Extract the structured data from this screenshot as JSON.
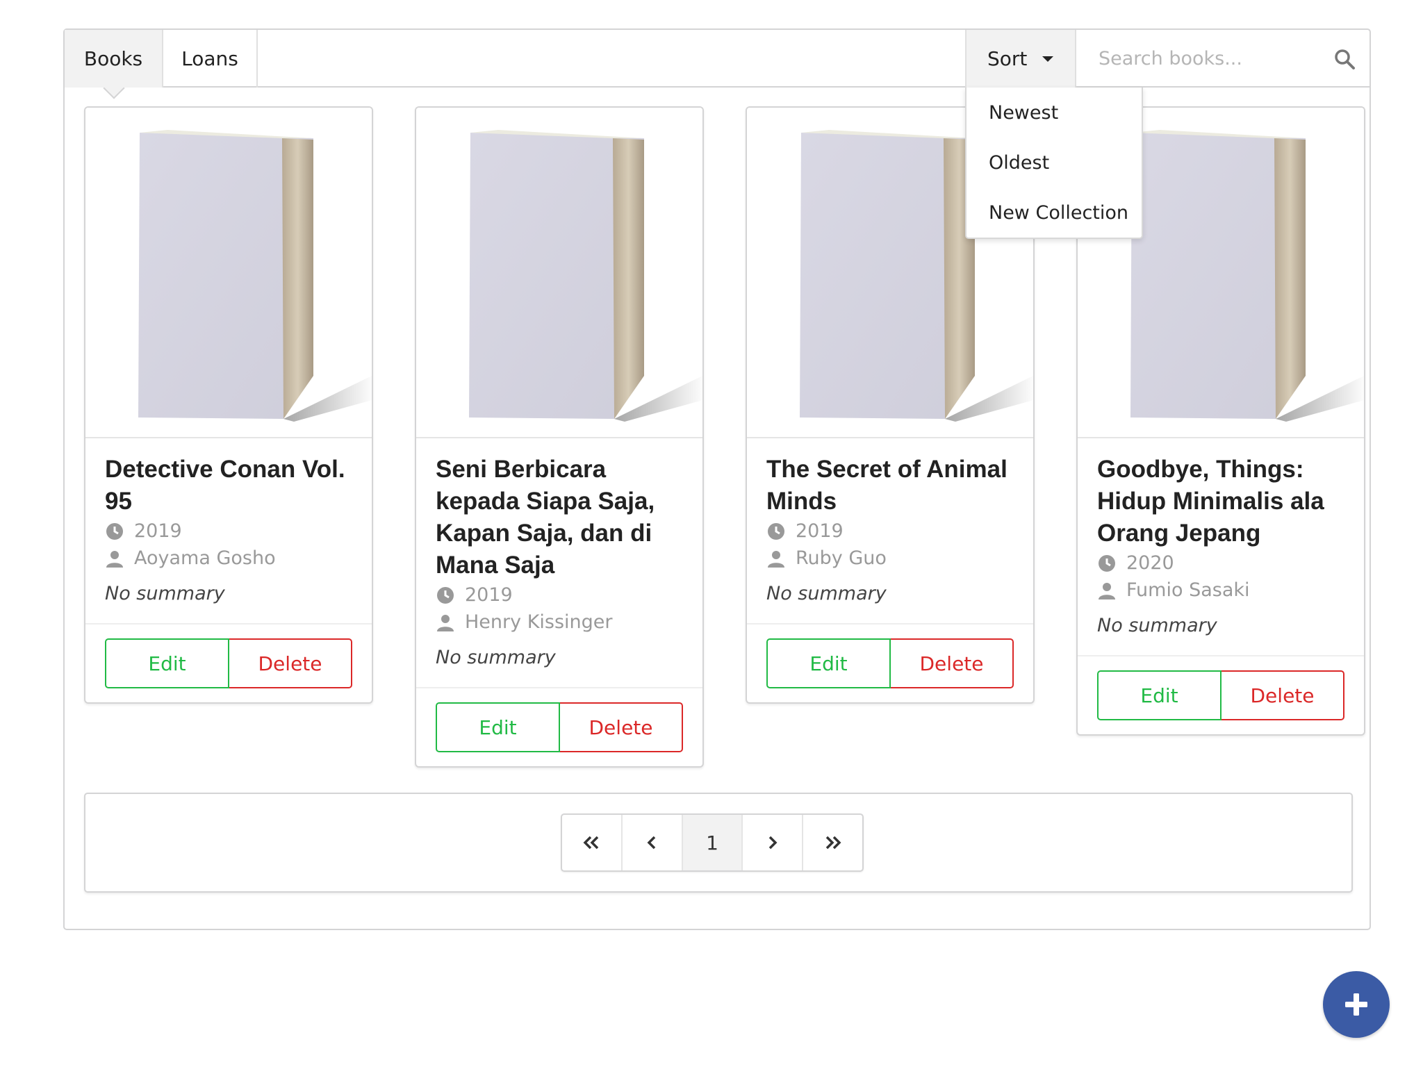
{
  "tabs": [
    {
      "label": "Books",
      "active": true
    },
    {
      "label": "Loans",
      "active": false
    }
  ],
  "sort": {
    "label": "Sort",
    "options": [
      "Newest",
      "Oldest",
      "New Collection"
    ]
  },
  "search": {
    "placeholder": "Search books...",
    "value": ""
  },
  "books": [
    {
      "title": "Detective Conan Vol. 95",
      "year": "2019",
      "author": "Aoyama Gosho",
      "summary": "No summary"
    },
    {
      "title": "Seni Berbicara kepada Siapa Saja, Kapan Saja, dan di Mana Saja",
      "year": "2019",
      "author": "Henry Kissinger",
      "summary": "No summary"
    },
    {
      "title": "The Secret of Animal Minds",
      "year": "2019",
      "author": "Ruby Guo",
      "summary": "No summary"
    },
    {
      "title": "Goodbye, Things: Hidup Minimalis ala Orang Jepang",
      "year": "2020",
      "author": "Fumio Sasaki",
      "summary": "No summary"
    }
  ],
  "actions": {
    "edit": "Edit",
    "delete": "Delete"
  },
  "pagination": {
    "current": "1"
  },
  "colors": {
    "edit": "#21ba45",
    "delete": "#db2828",
    "fab": "#3b5ba5"
  },
  "icons": {
    "search": "search-icon",
    "year": "clock-icon",
    "author": "user-icon",
    "fab": "plus-icon"
  }
}
